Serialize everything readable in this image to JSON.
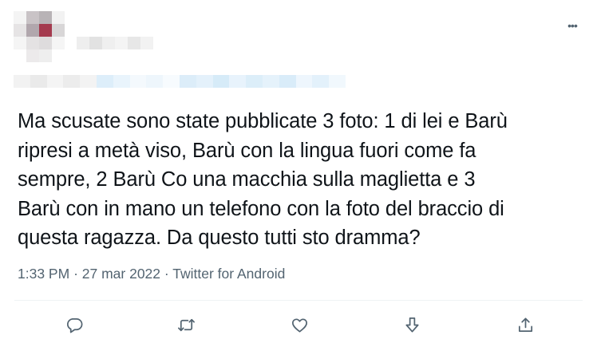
{
  "tweet": {
    "text_lines": [
      "Ma scusate sono state pubblicate 3 foto: 1 di lei e Barù",
      "ripresi a metà viso, Barù con la lingua fuori come fa",
      "sempre, 2 Barù Co una macchia sulla maglietta e 3",
      "Barù con in mano un telefono con la foto del braccio di",
      "questa ragazza. Da questo tutti sto dramma?"
    ],
    "time": "1:33 PM",
    "date": "27 mar 2022",
    "separator": "·",
    "source": "Twitter for Android"
  },
  "header": {
    "more_label": "•••"
  },
  "actions": {
    "icons": [
      "reply-icon",
      "retweet-icon",
      "like-icon",
      "downvote-icon",
      "share-icon"
    ]
  },
  "colors": {
    "text": "#0f1419",
    "secondary": "#536471",
    "divider": "#eff3f4",
    "blur_blue": "#d6ebf8"
  }
}
